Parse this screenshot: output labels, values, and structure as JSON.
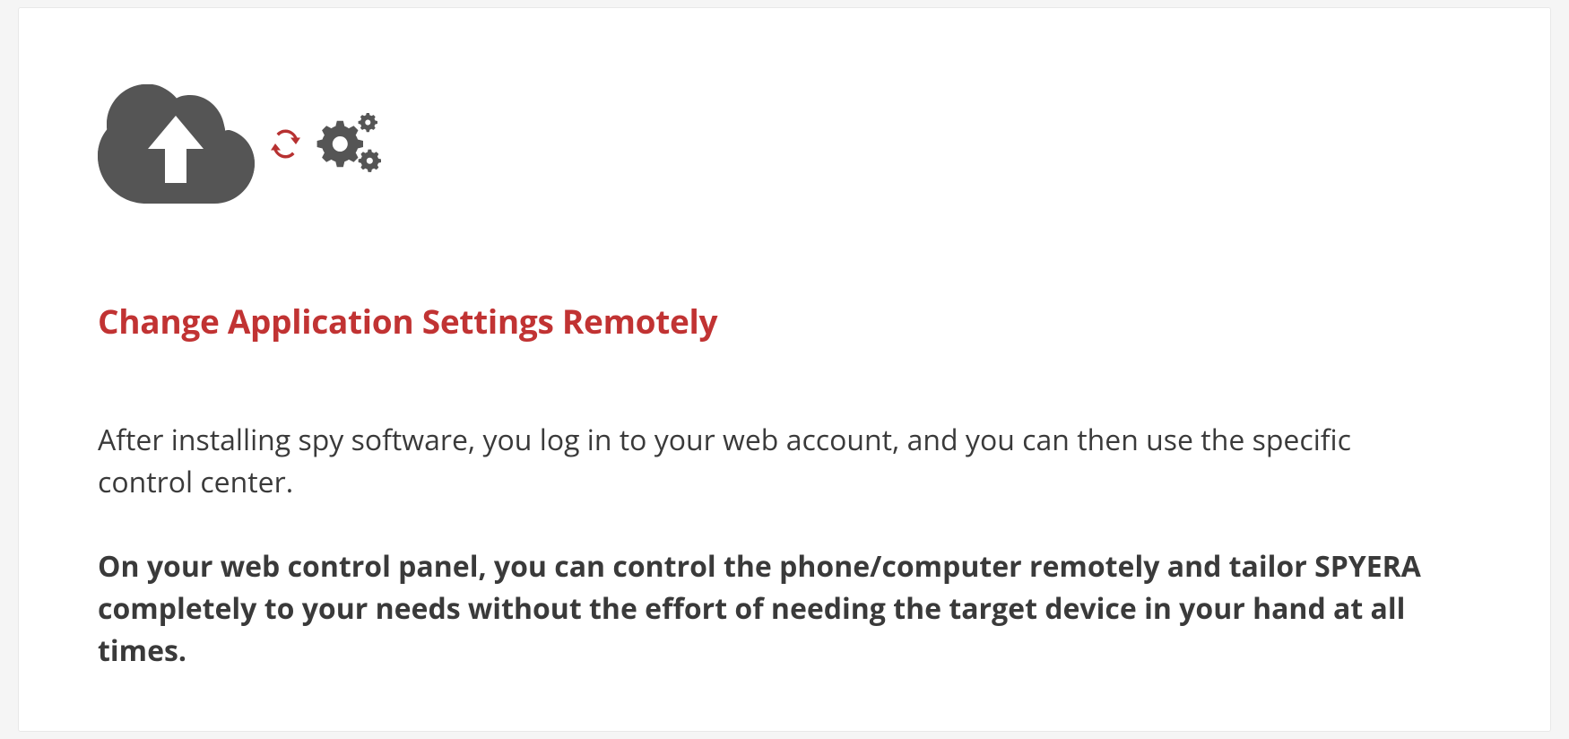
{
  "heading": "Change Application Settings Remotely",
  "paragraph1": "After installing spy software, you log in to your web account, and you can then use the specific control center.",
  "paragraph2": "On your web control panel, you can control the phone/computer remotely and tailor SPYERA completely to your needs without the effort of needing the target device in your hand at all times.",
  "colors": {
    "heading": "#c13333",
    "iconGray": "#555555",
    "syncRed": "#b73131",
    "bodyText": "#3a3a3a"
  }
}
